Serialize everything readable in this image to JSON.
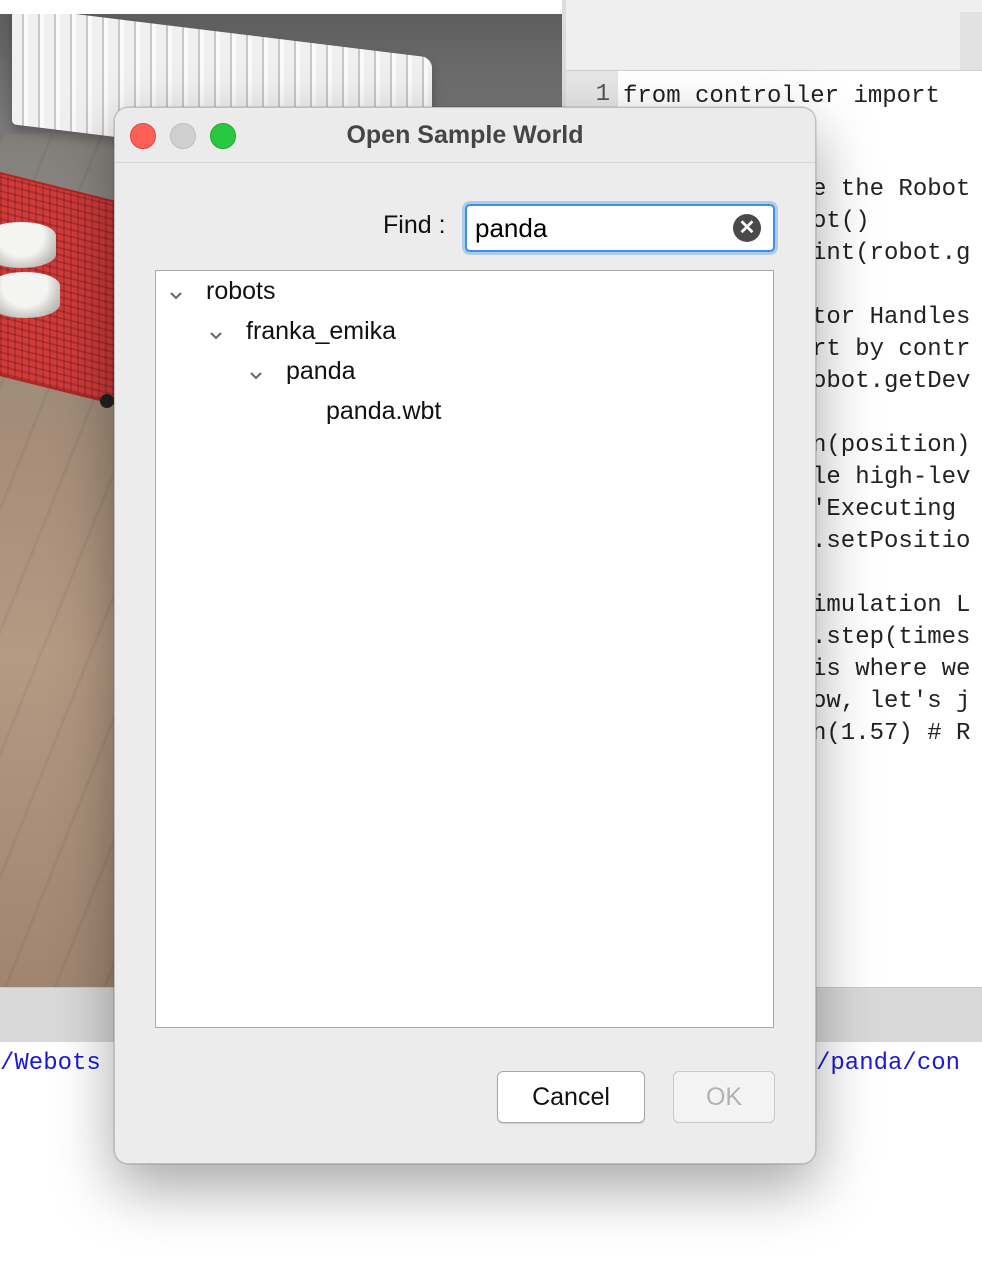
{
  "editor": {
    "line_number": "1",
    "first_line": "from controller import",
    "fragments": [
      "e the Robot",
      "ot()",
      "int(robot.g",
      "tor Handles",
      "rt by contr",
      "obot.getDev",
      "n(position)",
      "le high-lev",
      "'Executing ",
      ".setPositio",
      "imulation L",
      ".step(times",
      "is where we",
      "ow, let's j",
      "n(1.57) # R"
    ]
  },
  "console": {
    "left_text": "/Webots",
    "right_text": "/panda/con"
  },
  "dialog": {
    "title": "Open Sample World",
    "find_label": "Find :",
    "find_value": "panda",
    "tree": {
      "level1": "robots",
      "level2": "franka_emika",
      "level3": "panda",
      "level4": "panda.wbt"
    },
    "cancel_label": "Cancel",
    "ok_label": "OK"
  },
  "icons": {
    "clear": "clear-icon",
    "expand": "chevron-down-icon"
  },
  "colors": {
    "accent": "#3d8ee8",
    "close": "#fe5f57",
    "maximize": "#29c840",
    "console_link": "#1a1ad6"
  }
}
